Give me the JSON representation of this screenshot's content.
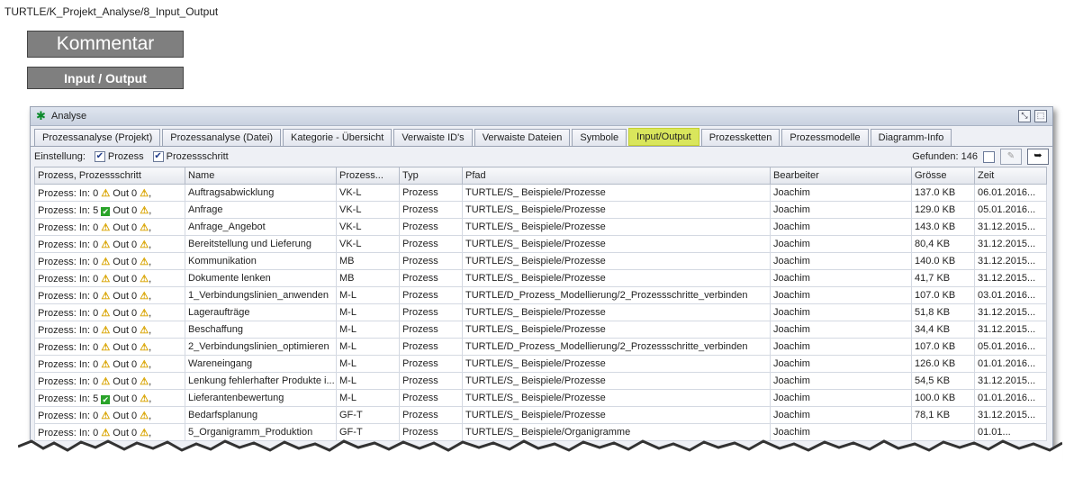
{
  "breadcrumb": "TURTLE/K_Projekt_Analyse/8_Input_Output",
  "buttons": {
    "kommentar": "Kommentar",
    "input_output": "Input / Output"
  },
  "panel": {
    "title": "Analyse",
    "tabs": [
      "Prozessanalyse (Projekt)",
      "Prozessanalyse (Datei)",
      "Kategorie - Übersicht",
      "Verwaiste ID's",
      "Verwaiste Dateien",
      "Symbole",
      "Input/Output",
      "Prozessketten",
      "Prozessmodelle",
      "Diagramm-Info"
    ],
    "active_tab": "Input/Output",
    "active_color": "#d9e65c",
    "settings": {
      "label": "Einstellung:",
      "prozess": "Prozess",
      "prozessschritt": "Prozessschritt",
      "found": "Gefunden: 146"
    }
  },
  "table": {
    "headers": [
      "Prozess, Prozessschritt",
      "Name",
      "Prozess...",
      "Typ",
      "Pfad",
      "Bearbeiter",
      "Grösse",
      "Zeit"
    ],
    "rows": [
      {
        "in": "Prozess: In: 0",
        "in_icon": "warn",
        "out": "Out 0",
        "name": "Auftragsabwicklung",
        "code": "VK-L",
        "typ": "Prozess",
        "pfad": "TURTLE/S_ Beispiele/Prozesse",
        "bearbeiter": "Joachim",
        "groesse": "137.0 KB",
        "zeit": "06.01.2016..."
      },
      {
        "in": "Prozess: In: 5",
        "in_icon": "ok",
        "out": "Out 0",
        "name": "Anfrage",
        "code": "VK-L",
        "typ": "Prozess",
        "pfad": "TURTLE/S_ Beispiele/Prozesse",
        "bearbeiter": "Joachim",
        "groesse": "129.0 KB",
        "zeit": "05.01.2016..."
      },
      {
        "in": "Prozess: In: 0",
        "in_icon": "warn",
        "out": "Out 0",
        "name": "Anfrage_Angebot",
        "code": "VK-L",
        "typ": "Prozess",
        "pfad": "TURTLE/S_ Beispiele/Prozesse",
        "bearbeiter": "Joachim",
        "groesse": "143.0 KB",
        "zeit": "31.12.2015..."
      },
      {
        "in": "Prozess: In: 0",
        "in_icon": "warn",
        "out": "Out 0",
        "name": "Bereitstellung und Lieferung",
        "code": "VK-L",
        "typ": "Prozess",
        "pfad": "TURTLE/S_ Beispiele/Prozesse",
        "bearbeiter": "Joachim",
        "groesse": "80,4 KB",
        "zeit": "31.12.2015..."
      },
      {
        "in": "Prozess: In: 0",
        "in_icon": "warn",
        "out": "Out 0",
        "name": "Kommunikation",
        "code": "MB",
        "typ": "Prozess",
        "pfad": "TURTLE/S_ Beispiele/Prozesse",
        "bearbeiter": "Joachim",
        "groesse": "140.0 KB",
        "zeit": "31.12.2015..."
      },
      {
        "in": "Prozess: In: 0",
        "in_icon": "warn",
        "out": "Out 0",
        "name": "Dokumente lenken",
        "code": "MB",
        "typ": "Prozess",
        "pfad": "TURTLE/S_ Beispiele/Prozesse",
        "bearbeiter": "Joachim",
        "groesse": "41,7 KB",
        "zeit": "31.12.2015..."
      },
      {
        "in": "Prozess: In: 0",
        "in_icon": "warn",
        "out": "Out 0",
        "name": "1_Verbindungslinien_anwenden",
        "code": "M-L",
        "typ": "Prozess",
        "pfad": "TURTLE/D_Prozess_Modellierung/2_Prozessschritte_verbinden",
        "bearbeiter": "Joachim",
        "groesse": "107.0 KB",
        "zeit": "03.01.2016..."
      },
      {
        "in": "Prozess: In: 0",
        "in_icon": "warn",
        "out": "Out 0",
        "name": "Lageraufträge",
        "code": "M-L",
        "typ": "Prozess",
        "pfad": "TURTLE/S_ Beispiele/Prozesse",
        "bearbeiter": "Joachim",
        "groesse": "51,8 KB",
        "zeit": "31.12.2015..."
      },
      {
        "in": "Prozess: In: 0",
        "in_icon": "warn",
        "out": "Out 0",
        "name": "Beschaffung",
        "code": "M-L",
        "typ": "Prozess",
        "pfad": "TURTLE/S_ Beispiele/Prozesse",
        "bearbeiter": "Joachim",
        "groesse": "34,4 KB",
        "zeit": "31.12.2015..."
      },
      {
        "in": "Prozess: In: 0",
        "in_icon": "warn",
        "out": "Out 0",
        "name": "2_Verbindungslinien_optimieren",
        "code": "M-L",
        "typ": "Prozess",
        "pfad": "TURTLE/D_Prozess_Modellierung/2_Prozessschritte_verbinden",
        "bearbeiter": "Joachim",
        "groesse": "107.0 KB",
        "zeit": "05.01.2016..."
      },
      {
        "in": "Prozess: In: 0",
        "in_icon": "warn",
        "out": "Out 0",
        "name": "Wareneingang",
        "code": "M-L",
        "typ": "Prozess",
        "pfad": "TURTLE/S_ Beispiele/Prozesse",
        "bearbeiter": "Joachim",
        "groesse": "126.0 KB",
        "zeit": "01.01.2016..."
      },
      {
        "in": "Prozess: In: 0",
        "in_icon": "warn",
        "out": "Out 0",
        "name": "Lenkung fehlerhafter Produkte i...",
        "code": "M-L",
        "typ": "Prozess",
        "pfad": "TURTLE/S_ Beispiele/Prozesse",
        "bearbeiter": "Joachim",
        "groesse": "54,5 KB",
        "zeit": "31.12.2015..."
      },
      {
        "in": "Prozess: In: 5",
        "in_icon": "ok",
        "out": "Out 0",
        "name": "Lieferantenbewertung",
        "code": "M-L",
        "typ": "Prozess",
        "pfad": "TURTLE/S_ Beispiele/Prozesse",
        "bearbeiter": "Joachim",
        "groesse": "100.0 KB",
        "zeit": "01.01.2016..."
      },
      {
        "in": "Prozess: In: 0",
        "in_icon": "warn",
        "out": "Out 0",
        "name": "Bedarfsplanung",
        "code": "GF-T",
        "typ": "Prozess",
        "pfad": "TURTLE/S_ Beispiele/Prozesse",
        "bearbeiter": "Joachim",
        "groesse": "78,1 KB",
        "zeit": "31.12.2015..."
      },
      {
        "in": "Prozess: In: 0",
        "in_icon": "warn",
        "out": "Out 0",
        "name": "5_Organigramm_Produktion",
        "code": "GF-T",
        "typ": "Prozess",
        "pfad": "TURTLE/S_ Beispiele/Organigramme",
        "bearbeiter": "Joachim",
        "groesse": "",
        "zeit": "01.01..."
      }
    ]
  }
}
